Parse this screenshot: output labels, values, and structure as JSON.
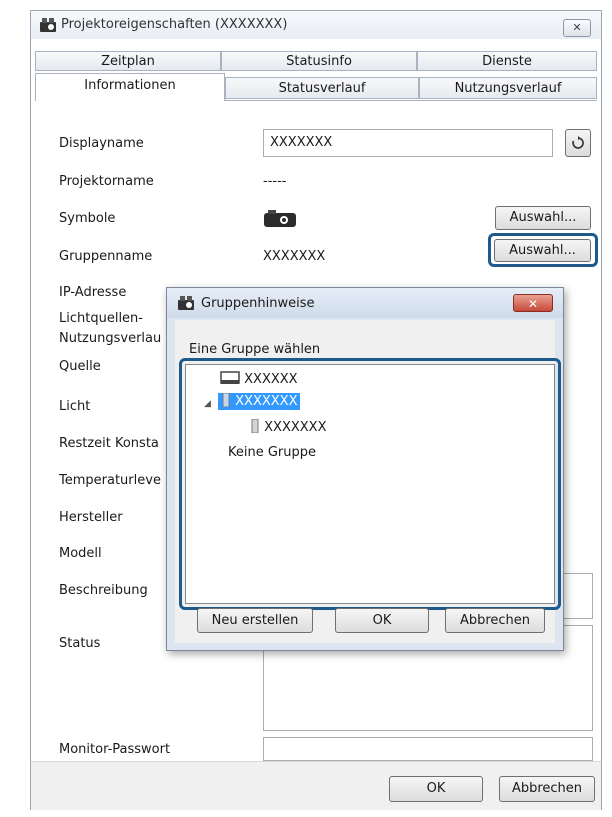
{
  "window": {
    "title": "Projektoreigenschaften (XXXXXXX)",
    "close_label": "✕"
  },
  "tabs": {
    "row1": [
      "Zeitplan",
      "Statusinfo",
      "Dienste"
    ],
    "row2": [
      "Informationen",
      "Statusverlauf",
      "Nutzungsverlauf"
    ]
  },
  "form": {
    "labels": {
      "displayname": "Displayname",
      "projektorname": "Projektorname",
      "symbole": "Symbole",
      "gruppenname": "Gruppenname",
      "ip_adresse": "IP-Adresse",
      "lichtquellen_1": "Lichtquellen-",
      "lichtquellen_2": "Nutzungsverlau",
      "quelle": "Quelle",
      "licht": "Licht",
      "restzeit": "Restzeit Konsta",
      "temperatur": "Temperaturleve",
      "hersteller": "Hersteller",
      "modell": "Modell",
      "beschreibung": "Beschreibung",
      "status": "Status",
      "monitor_passwort": "Monitor-Passwort"
    },
    "values": {
      "displayname": "XXXXXXX",
      "projektorname": "-----",
      "gruppenname": "XXXXXXX"
    },
    "auswahl_symbol_label": "Auswahl...",
    "auswahl_gruppe_label": "Auswahl..."
  },
  "footer": {
    "ok_label": "OK",
    "cancel_label": "Abbrechen"
  },
  "dialog": {
    "title": "Gruppenhinweise",
    "close_label": "✕",
    "prompt": "Eine Gruppe wählen",
    "tree": {
      "item1": "XXXXXX",
      "item2": "XXXXXXX",
      "item3": "XXXXXXX",
      "item4": "Keine Gruppe"
    },
    "new_label": "Neu erstellen",
    "ok_label": "OK",
    "cancel_label": "Abbrechen"
  },
  "colors": {
    "highlight": "#1f5a8a",
    "selection": "#3399ff"
  }
}
